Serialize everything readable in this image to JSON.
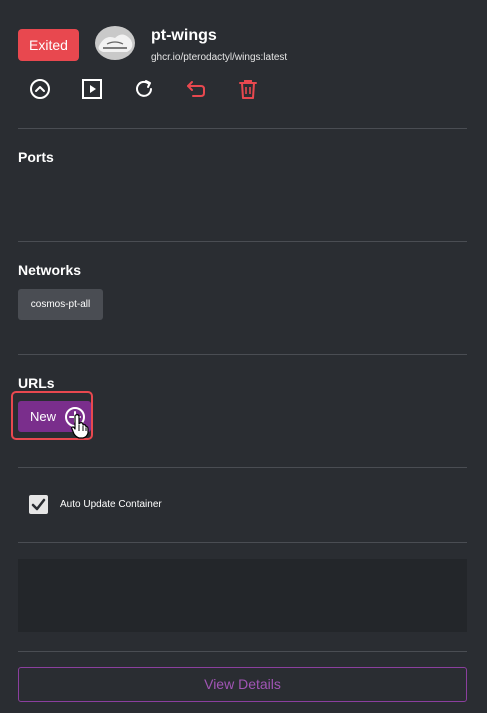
{
  "container": {
    "status": "Exited",
    "name": "pt-wings",
    "image": "ghcr.io/pterodactyl/wings:latest"
  },
  "toolbar": {
    "buttons": [
      {
        "icon": "arrow-up-circle-icon"
      },
      {
        "icon": "play-square-icon"
      },
      {
        "icon": "refresh-icon"
      },
      {
        "icon": "undo-icon"
      },
      {
        "icon": "trash-icon"
      }
    ]
  },
  "sections": {
    "ports": "Ports",
    "networks": "Networks",
    "urls": "URLs"
  },
  "networks": [
    "cosmos-pt-all"
  ],
  "urls": {
    "new_label": "New"
  },
  "auto_update": {
    "label": "Auto Update Container",
    "checked": true
  },
  "footer": {
    "view_details": "View Details"
  },
  "colors": {
    "background": "#2a2d32",
    "status_exited": "#e8484f",
    "accent_purple": "#7a2e8c",
    "link_purple": "#a155b5",
    "danger_red": "#e8484f"
  }
}
